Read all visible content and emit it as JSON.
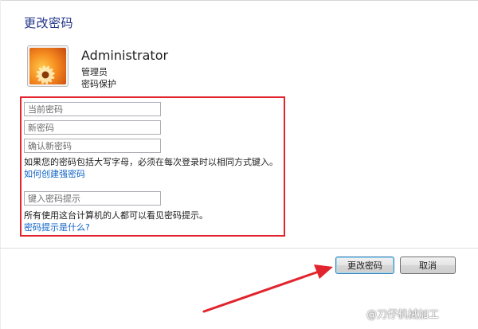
{
  "page": {
    "title": "更改密码"
  },
  "user": {
    "name": "Administrator",
    "role": "管理员",
    "status": "密码保护"
  },
  "form": {
    "current_password_placeholder": "当前密码",
    "new_password_placeholder": "新密码",
    "confirm_password_placeholder": "确认新密码",
    "caps_note": "如果您的密码包括大写字母，必须在每次登录时以相同方式键入。",
    "strong_password_link": "如何创建强密码",
    "hint_placeholder": "键入密码提示",
    "hint_note": "所有使用这台计算机的人都可以看见密码提示。",
    "hint_link": "密码提示是什么?"
  },
  "buttons": {
    "confirm_label": "更改密码",
    "cancel_label": "取消"
  },
  "watermark": {
    "text": "@刀仔机械加工"
  },
  "colors": {
    "title_blue": "#1e3287",
    "link_blue": "#0f62c6",
    "highlight_red": "#e1242d"
  },
  "icons": {
    "avatar": "orange-flower-icon",
    "annotation": "red-arrow-icon"
  }
}
